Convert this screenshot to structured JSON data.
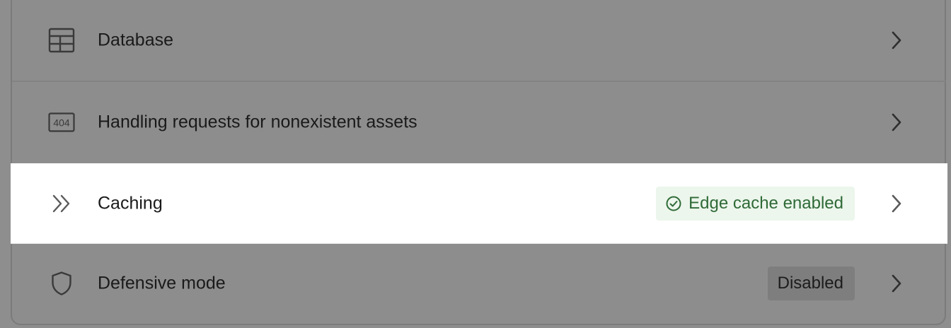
{
  "settings": {
    "rows": [
      {
        "label": "Database",
        "icon": "table-icon"
      },
      {
        "label": "Handling requests for nonexistent assets",
        "icon": "404-icon",
        "icon_text": "404"
      },
      {
        "label": "Caching",
        "icon": "double-chevron-right-icon",
        "badge": "Edge cache enabled",
        "badge_icon": "check-circle-icon",
        "badge_color": "#2f6a37"
      },
      {
        "label": "Defensive mode",
        "icon": "shield-icon",
        "badge": "Disabled"
      }
    ]
  },
  "colors": {
    "overlay": "#8e8e8e",
    "highlight_row": "#ffffff",
    "success_badge_bg": "#ecf6ec",
    "success_badge_text": "#2f6a37"
  }
}
